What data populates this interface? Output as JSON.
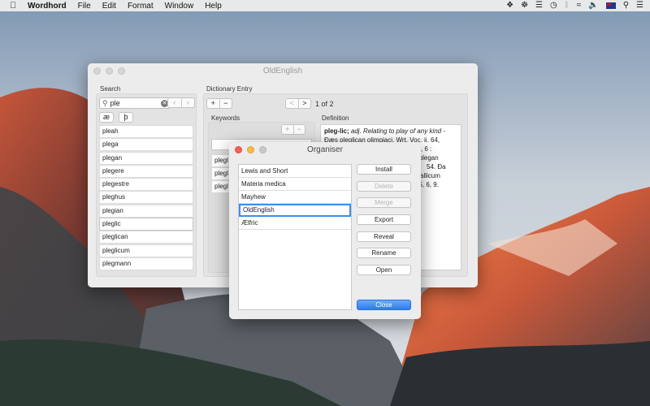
{
  "menubar": {
    "app": "Wordhord",
    "items": [
      "File",
      "Edit",
      "Format",
      "Window",
      "Help"
    ]
  },
  "main": {
    "title": "OldEnglish",
    "search_label": "Search",
    "search_value": "ple",
    "char_ae": "æ",
    "char_thorn": "þ",
    "results": [
      "pleah",
      "plega",
      "plegan",
      "plegere",
      "plegestre",
      "pleghus",
      "plegian",
      "pleglic",
      "pleglican",
      "pleglicum",
      "plegmann"
    ],
    "dict_entry_label": "Dictionary Entry",
    "add": "+",
    "remove": "−",
    "prev": "<",
    "next": ">",
    "page": "1 of 2",
    "keywords_label": "Keywords",
    "keywords": [
      "plegl",
      "plegl",
      "plegl"
    ],
    "definition_label": "Definition",
    "definition": {
      "head": "pleg-lic;",
      "pos": "adj.",
      "gloss": "Relating to play of any kind -",
      "lines": [
        "Ðæs pleglican olimpiaci, Wrt. Voc. ii. 64,",
        "74, 6 :",
        "n plegan",
        "54. Ða",
        "allicum",
        "05, 6, 9."
      ]
    }
  },
  "organiser": {
    "title": "Organiser",
    "dictionaries": [
      "Lewis and Short",
      "Materia medica",
      "Mayhew",
      "OldEnglish",
      "Ælfric"
    ],
    "selected_index": 3,
    "buttons": {
      "install": "Install",
      "delete": "Delete",
      "merge": "Merge",
      "export": "Export",
      "reveal": "Reveal",
      "rename": "Rename",
      "open": "Open",
      "close": "Close"
    }
  },
  "colors": {
    "accent": "#2e7bf0",
    "close_light": "#fc605c",
    "min_light": "#fdbc40"
  }
}
